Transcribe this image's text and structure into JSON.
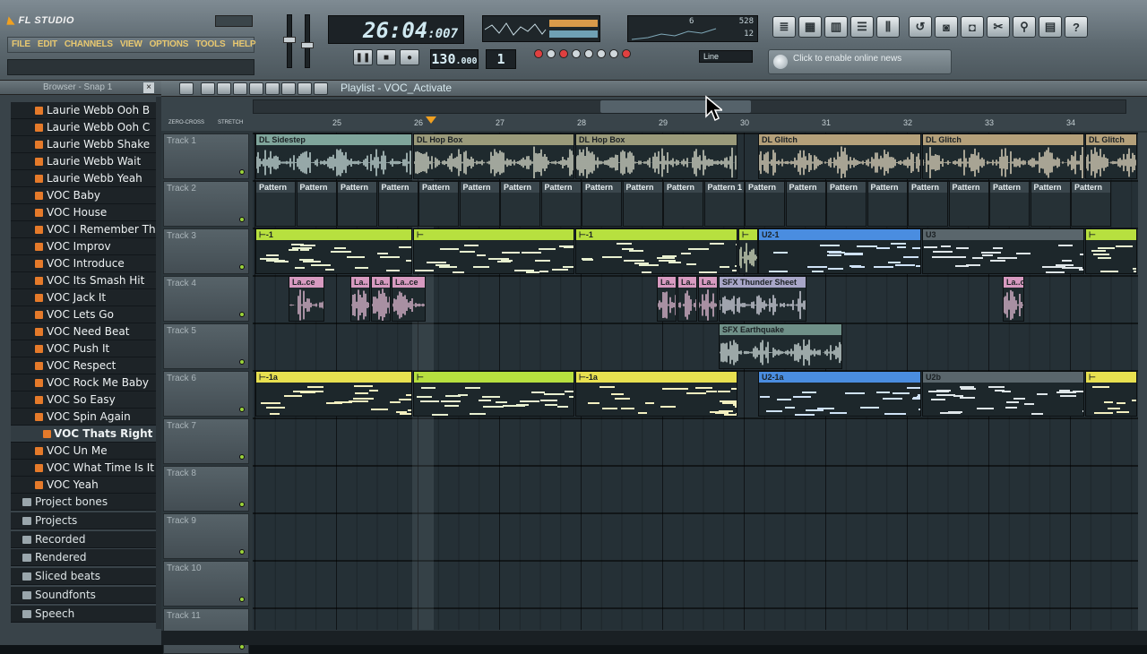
{
  "app": {
    "logo": "FL STUDIO",
    "menu": [
      "FILE",
      "EDIT",
      "CHANNELS",
      "VIEW",
      "OPTIONS",
      "TOOLS",
      "HELP"
    ]
  },
  "transport": {
    "time": "26:04",
    "time_ticks": ":007",
    "tempo": "130",
    "tempo_frac": ".000",
    "pattern": "1",
    "cpu": "6",
    "ram": "528",
    "poly": "12",
    "line_mode": "Line"
  },
  "news": {
    "text": "Click to enable online news"
  },
  "browser": {
    "title": "Browser - Snap 1",
    "items": [
      "Laurie Webb Ooh B",
      "Laurie Webb Ooh C",
      "Laurie Webb Shake",
      "Laurie Webb Wait",
      "Laurie Webb Yeah",
      "VOC Baby",
      "VOC House",
      "VOC I Remember That",
      "VOC Improv",
      "VOC Introduce",
      "VOC Its Smash Hit",
      "VOC Jack It",
      "VOC Lets Go",
      "VOC Need Beat",
      "VOC Push It",
      "VOC Respect",
      "VOC Rock Me Baby",
      "VOC So Easy",
      "VOC Spin Again",
      "VOC Thats Right",
      "VOC Un Me",
      "VOC What Time Is It",
      "VOC Yeah"
    ],
    "selected": "VOC Thats Right",
    "folders": [
      "Project bones",
      "Projects",
      "Recorded",
      "Rendered",
      "Sliced beats",
      "Soundfonts",
      "Speech"
    ]
  },
  "playlist": {
    "title": "Playlist - VOC_Activate",
    "zero_cross": "ZERO-CROSS",
    "stretch": "STRETCH",
    "bars": [
      "25",
      "26",
      "27",
      "28",
      "29",
      "30",
      "31",
      "32",
      "33",
      "34"
    ],
    "tracks": [
      "Track 1",
      "Track 2",
      "Track 3",
      "Track 4",
      "Track 5",
      "Track 6",
      "Track 7",
      "Track 8",
      "Track 9",
      "Track 10",
      "Track 11"
    ],
    "clips": {
      "t1a": "DL Sidestep",
      "t1b": "DL Hop Box",
      "t1c": "DL Hop Box",
      "t1d": "DL Glitch",
      "t1e": "DL Glitch",
      "t1f": "DL Glitch",
      "t2": "Pattern",
      "t2last": "Pattern 1",
      "t3a": "⊢-1",
      "t3b": "⊢",
      "t3c": "⊢-1",
      "t3d": "⊢",
      "t3e": "U2-1",
      "t3f": "U3",
      "t3g": "⊢",
      "t4a": "La..ce",
      "t4b": "La..",
      "t4c": "La..",
      "t4d": "La..ce",
      "t4e": "La..",
      "t4f": "La..",
      "t4g": "La..",
      "t4h": "SFX Thunder Sheet",
      "t5": "SFX Earthquake",
      "t6a": "⊢-1a",
      "t6b": "⊢",
      "t6c": "⊢-1a",
      "t6d": "U2-1a",
      "t6e": "U2b",
      "t6f": "⊢"
    }
  },
  "colors": {
    "accent": "#e8c870",
    "green": "#b7e03f",
    "yellow": "#e8e050",
    "blue": "#4a8de0",
    "pink": "#d79ac0",
    "teal": "#6fa39a"
  }
}
